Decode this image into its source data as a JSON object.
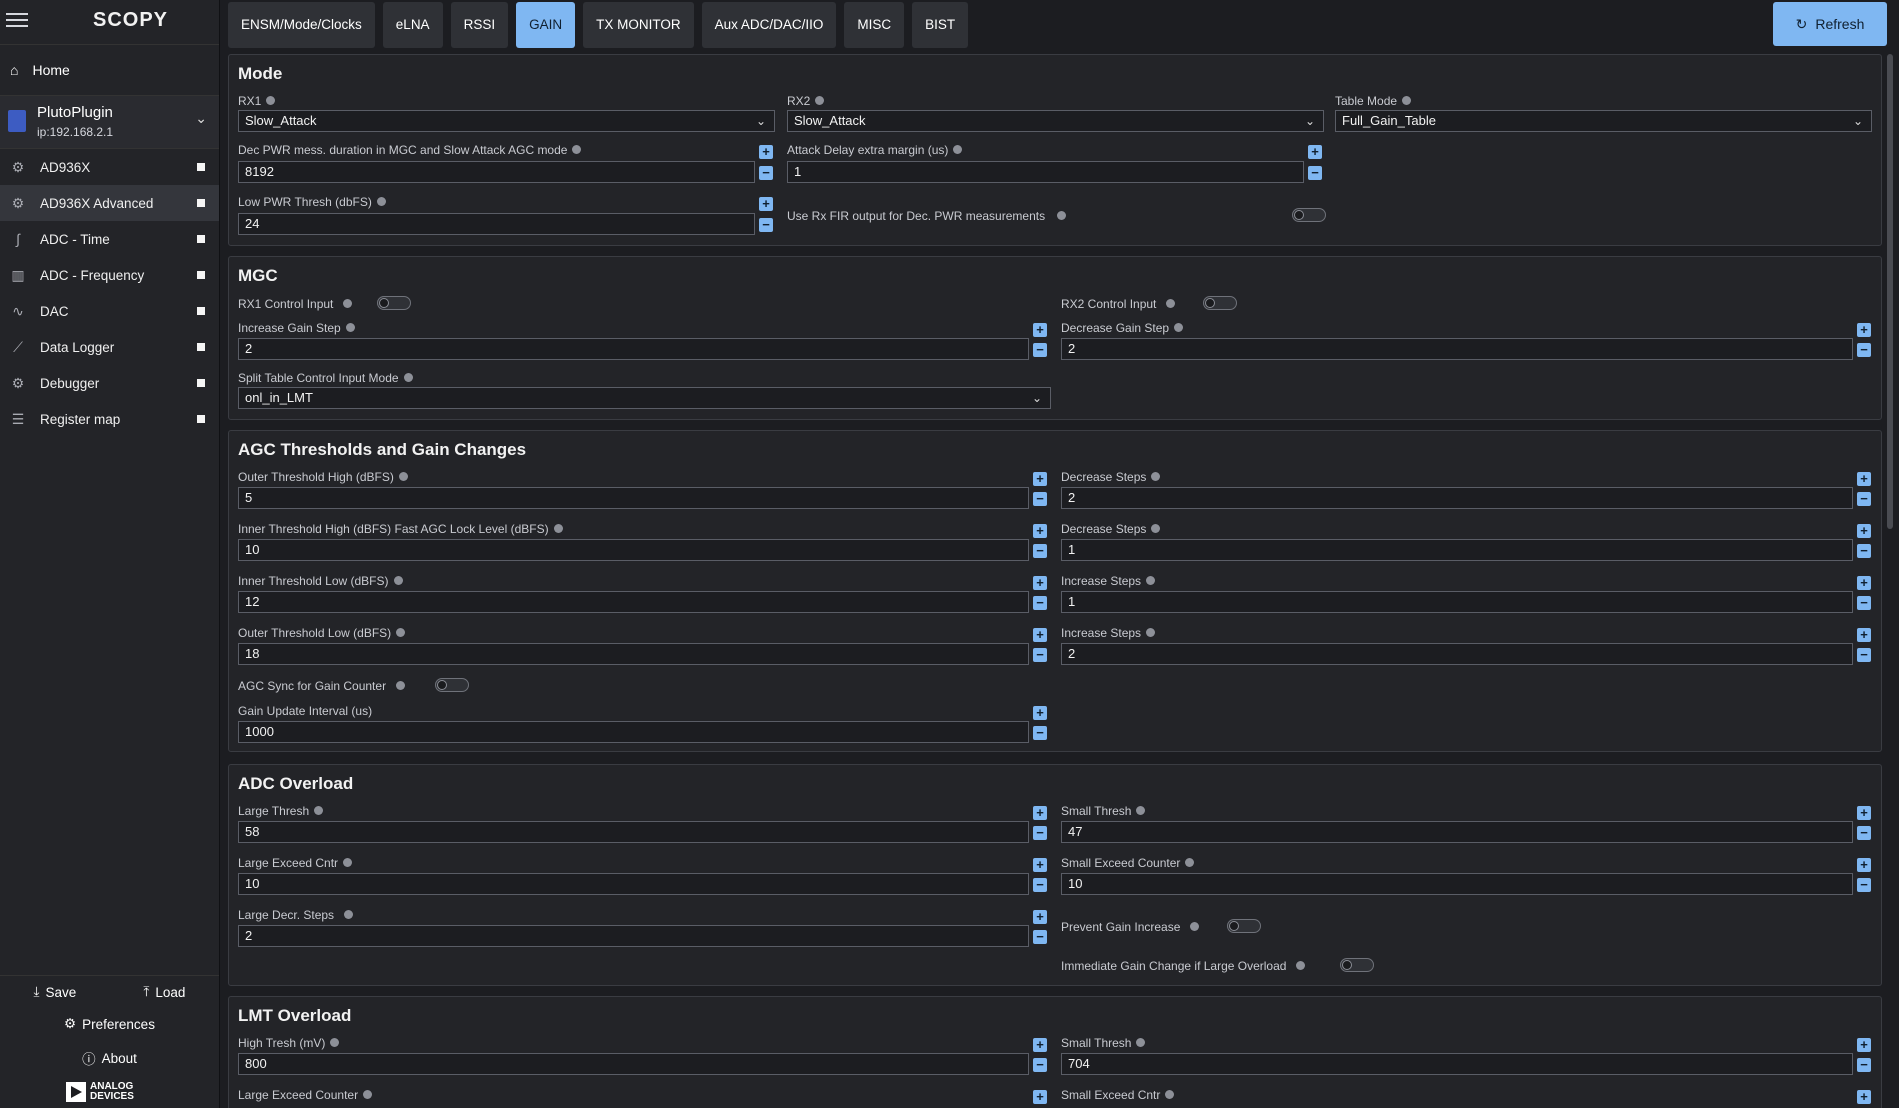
{
  "app": {
    "logo": "SCOPY"
  },
  "sidebar": {
    "home": "Home",
    "device": {
      "name": "PlutoPlugin",
      "ip": "ip:192.168.2.1"
    },
    "tools": [
      {
        "label": "AD936X",
        "icon": "gear-icon"
      },
      {
        "label": "AD936X Advanced",
        "icon": "gear-icon"
      },
      {
        "label": "ADC - Time",
        "icon": "time-wave-icon"
      },
      {
        "label": "ADC - Frequency",
        "icon": "spectrum-icon"
      },
      {
        "label": "DAC",
        "icon": "dac-wave-icon"
      },
      {
        "label": "Data Logger",
        "icon": "chart-icon"
      },
      {
        "label": "Debugger",
        "icon": "gear-icon"
      },
      {
        "label": "Register map",
        "icon": "sliders-icon"
      }
    ],
    "save": "Save",
    "load": "Load",
    "preferences": "Preferences",
    "about": "About",
    "brand_line1": "ANALOG",
    "brand_line2": "DEVICES"
  },
  "tabs": [
    "ENSM/Mode/Clocks",
    "eLNA",
    "RSSI",
    "GAIN",
    "TX MONITOR",
    "Aux ADC/DAC/IIO",
    "MISC",
    "BIST"
  ],
  "refresh": "Refresh",
  "mode": {
    "title": "Mode",
    "rx1_label": "RX1",
    "rx1_value": "Slow_Attack",
    "rx2_label": "RX2",
    "rx2_value": "Slow_Attack",
    "table_mode_label": "Table Mode",
    "table_mode_value": "Full_Gain_Table",
    "dec_pwr_label": "Dec PWR mess. duration in MGC and Slow Attack AGC mode",
    "dec_pwr_value": "8192",
    "attack_delay_label": "Attack Delay extra margin (us)",
    "attack_delay_value": "1",
    "low_pwr_label": "Low PWR Thresh (dbFS)",
    "low_pwr_value": "24",
    "use_rx_fir_label": "Use Rx FIR output for Dec. PWR measurements"
  },
  "mgc": {
    "title": "MGC",
    "rx1_ctrl_label": "RX1 Control Input",
    "rx2_ctrl_label": "RX2 Control Input",
    "inc_step_label": "Increase Gain Step",
    "inc_step_value": "2",
    "dec_step_label": "Decrease Gain Step",
    "dec_step_value": "2",
    "split_label": "Split Table Control Input Mode",
    "split_value": "onl_in_LMT"
  },
  "agc": {
    "title": "AGC Thresholds and Gain Changes",
    "outer_high_label": "Outer Threshold High (dBFS)",
    "outer_high_value": "5",
    "dec_steps1_label": "Decrease Steps",
    "dec_steps1_value": "2",
    "inner_high_label": "Inner Threshold High (dBFS) Fast AGC Lock Level (dBFS)",
    "inner_high_value": "10",
    "dec_steps2_label": "Decrease Steps",
    "dec_steps2_value": "1",
    "inner_low_label": "Inner Threshold Low (dBFS)",
    "inner_low_value": "12",
    "inc_steps1_label": "Increase Steps",
    "inc_steps1_value": "1",
    "outer_low_label": "Outer Threshold Low (dBFS)",
    "outer_low_value": "18",
    "inc_steps2_label": "Increase Steps",
    "inc_steps2_value": "2",
    "sync_label": "AGC Sync for Gain Counter",
    "gain_update_label": "Gain Update Interval (us)",
    "gain_update_value": "1000"
  },
  "adc": {
    "title": "ADC Overload",
    "large_thresh_label": "Large Thresh",
    "large_thresh_value": "58",
    "small_thresh_label": "Small Thresh",
    "small_thresh_value": "47",
    "large_exceed_label": "Large Exceed Cntr",
    "large_exceed_value": "10",
    "small_exceed_label": "Small Exceed Counter",
    "small_exceed_value": "10",
    "large_decr_label": "Large Decr. Steps",
    "large_decr_value": "2",
    "prevent_label": "Prevent Gain Increase",
    "immediate_label": "Immediate Gain Change if Large Overload"
  },
  "lmt": {
    "title": "LMT Overload",
    "high_tresh_label": "High Tresh (mV)",
    "high_tresh_value": "800",
    "small_thresh_label": "Small Thresh",
    "small_thresh_value": "704",
    "large_exceed_label": "Large Exceed Counter",
    "small_exceed_label": "Small Exceed Cntr"
  },
  "colors": {
    "accent": "#7fb7f2",
    "background": "#1c1d21",
    "panel": "#232428"
  }
}
